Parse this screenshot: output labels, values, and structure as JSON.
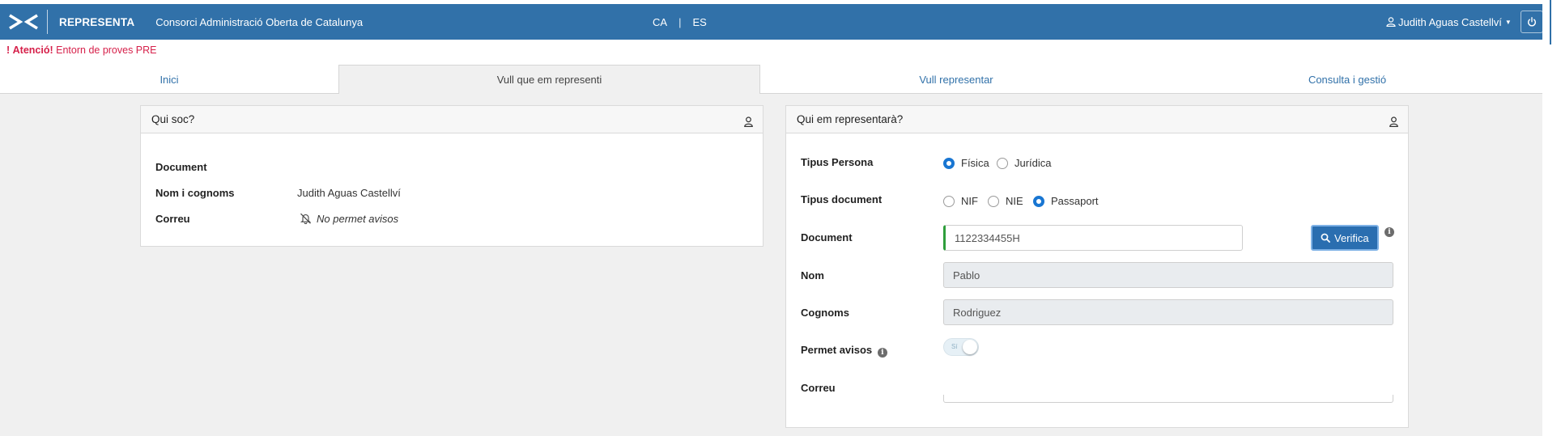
{
  "header": {
    "app_name": "REPRESENTA",
    "org_name": "Consorci Administració Oberta de Catalunya",
    "lang_ca": "CA",
    "lang_separator": "|",
    "lang_es": "ES",
    "user_name": "Judith Aguas Castellví",
    "brand_color": "#3171a9"
  },
  "alert": {
    "bold": "Atenció!",
    "text": "Entorn de proves PRE"
  },
  "tabs": [
    {
      "label": "Inici"
    },
    {
      "label": "Vull que em representi"
    },
    {
      "label": "Vull representar"
    },
    {
      "label": "Consulta i gestió"
    }
  ],
  "left_panel": {
    "title": "Qui soc?",
    "rows": [
      {
        "label": "Document",
        "value": ""
      },
      {
        "label": "Nom i cognoms",
        "value": "Judith  Aguas Castellví"
      },
      {
        "label": "Correu",
        "value": "No permet avisos"
      }
    ]
  },
  "right_panel": {
    "title": "Qui em representarà?",
    "tipus_persona": {
      "label": "Tipus Persona",
      "options": [
        "Física",
        "Jurídica"
      ],
      "selected": "Física"
    },
    "tipus_document": {
      "label": "Tipus document",
      "options": [
        "NIF",
        "NIE",
        "Passaport"
      ],
      "selected": "Passaport"
    },
    "document": {
      "label": "Document",
      "value": "1122334455H",
      "button": "Verifica"
    },
    "nom": {
      "label": "Nom",
      "value": "Pablo"
    },
    "cognoms": {
      "label": "Cognoms",
      "value": "Rodriguez"
    },
    "permet_avisos": {
      "label": "Permet avisos",
      "toggle_label": "Sí"
    },
    "correu": {
      "label": "Correu"
    }
  }
}
